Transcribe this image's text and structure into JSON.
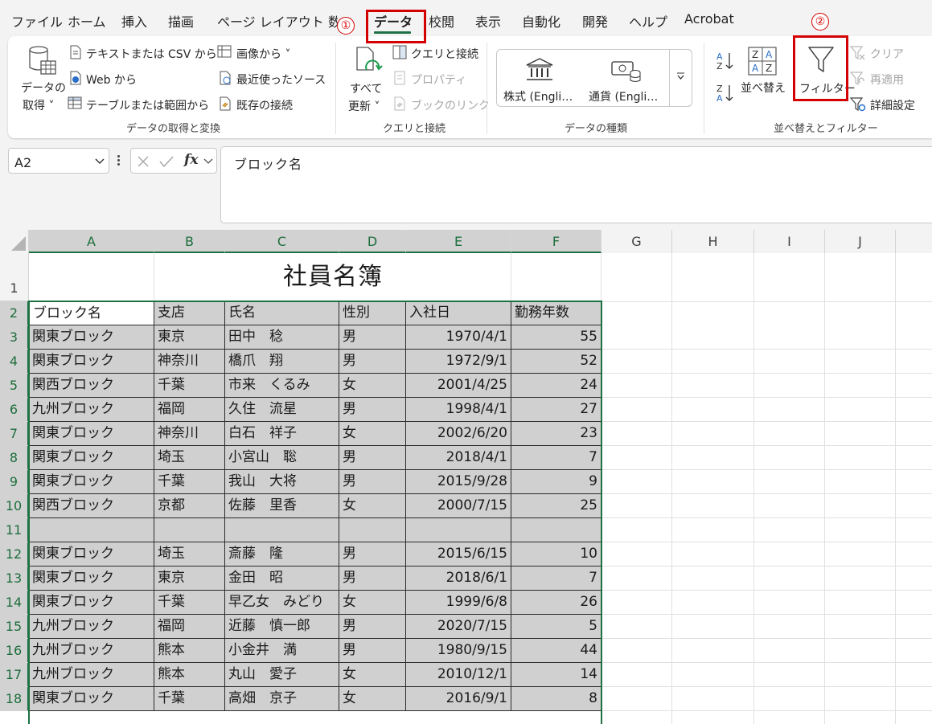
{
  "menu": {
    "tabs": [
      "ファイル",
      "ホーム",
      "挿入",
      "描画",
      "ページ レイアウト",
      "数",
      "データ",
      "校閲",
      "表示",
      "自動化",
      "開発",
      "ヘルプ",
      "Acrobat"
    ],
    "active_tab": "データ"
  },
  "annotations": {
    "step1": "①",
    "step2": "②",
    "highlight_color": "#d40000"
  },
  "ribbon": {
    "get_data": {
      "get_data_btn": [
        "データの",
        "取得 ˅"
      ],
      "text_csv": "テキストまたは CSV から",
      "web": "Web から",
      "table_range": "テーブルまたは範囲から",
      "from_picture": "画像から ˅",
      "recent_sources": "最近使ったソース",
      "existing_connections": "既存の接続",
      "group_label": "データの取得と変換"
    },
    "queries": {
      "refresh_all": [
        "すべて",
        "更新 ˅"
      ],
      "queries_connections": "クエリと接続",
      "properties": "プロパティ",
      "workbook_links": "ブックのリンク",
      "group_label": "クエリと接続"
    },
    "data_types": {
      "stocks": "株式 (Engli…",
      "currencies": "通貨 (Engli…",
      "group_label": "データの種類"
    },
    "sort_filter": {
      "sort": "並べ替え",
      "filter": "フィルター",
      "clear": "クリア",
      "reapply": "再適用",
      "advanced": "詳細設定",
      "group_label": "並べ替えとフィルター"
    }
  },
  "formula_bar": {
    "name_box": "A2",
    "fx": "fx",
    "content": "ブロック名"
  },
  "sheet": {
    "columns": [
      "A",
      "B",
      "C",
      "D",
      "E",
      "F",
      "G",
      "H",
      "I",
      "J"
    ],
    "title": "社員名簿",
    "headers": [
      "ブロック名",
      "支店",
      "氏名",
      "性別",
      "入社日",
      "勤務年数"
    ],
    "rows": [
      {
        "n": "3",
        "a": "関東ブロック",
        "b": "東京",
        "c": "田中　稔",
        "d": "男",
        "e": "1970/4/1",
        "f": "55"
      },
      {
        "n": "4",
        "a": "関東ブロック",
        "b": "神奈川",
        "c": "橋爪　翔",
        "d": "男",
        "e": "1972/9/1",
        "f": "52"
      },
      {
        "n": "5",
        "a": "関西ブロック",
        "b": "千葉",
        "c": "市来　くるみ",
        "d": "女",
        "e": "2001/4/25",
        "f": "24"
      },
      {
        "n": "6",
        "a": "九州ブロック",
        "b": "福岡",
        "c": "久住　流星",
        "d": "男",
        "e": "1998/4/1",
        "f": "27"
      },
      {
        "n": "7",
        "a": "関東ブロック",
        "b": "神奈川",
        "c": "白石　祥子",
        "d": "女",
        "e": "2002/6/20",
        "f": "23"
      },
      {
        "n": "8",
        "a": "関東ブロック",
        "b": "埼玉",
        "c": "小宮山　聡",
        "d": "男",
        "e": "2018/4/1",
        "f": "7"
      },
      {
        "n": "9",
        "a": "関東ブロック",
        "b": "千葉",
        "c": "我山　大将",
        "d": "男",
        "e": "2015/9/28",
        "f": "9"
      },
      {
        "n": "10",
        "a": "関西ブロック",
        "b": "京都",
        "c": "佐藤　里香",
        "d": "女",
        "e": "2000/7/15",
        "f": "25"
      },
      {
        "n": "11",
        "a": "",
        "b": "",
        "c": "",
        "d": "",
        "e": "",
        "f": ""
      },
      {
        "n": "12",
        "a": "関東ブロック",
        "b": "埼玉",
        "c": "斎藤　隆",
        "d": "男",
        "e": "2015/6/15",
        "f": "10"
      },
      {
        "n": "13",
        "a": "関東ブロック",
        "b": "東京",
        "c": "金田　昭",
        "d": "男",
        "e": "2018/6/1",
        "f": "7"
      },
      {
        "n": "14",
        "a": "関東ブロック",
        "b": "千葉",
        "c": "早乙女　みどり",
        "d": "女",
        "e": "1999/6/8",
        "f": "26"
      },
      {
        "n": "15",
        "a": "九州ブロック",
        "b": "福岡",
        "c": "近藤　慎一郎",
        "d": "男",
        "e": "2020/7/15",
        "f": "5"
      },
      {
        "n": "16",
        "a": "九州ブロック",
        "b": "熊本",
        "c": "小金井　満",
        "d": "男",
        "e": "1980/9/15",
        "f": "44"
      },
      {
        "n": "17",
        "a": "九州ブロック",
        "b": "熊本",
        "c": "丸山　愛子",
        "d": "女",
        "e": "2010/12/1",
        "f": "14"
      },
      {
        "n": "18",
        "a": "関東ブロック",
        "b": "千葉",
        "c": "高畑　京子",
        "d": "女",
        "e": "2016/9/1",
        "f": "8"
      }
    ],
    "row_numbers_top": [
      "1",
      "2"
    ]
  }
}
